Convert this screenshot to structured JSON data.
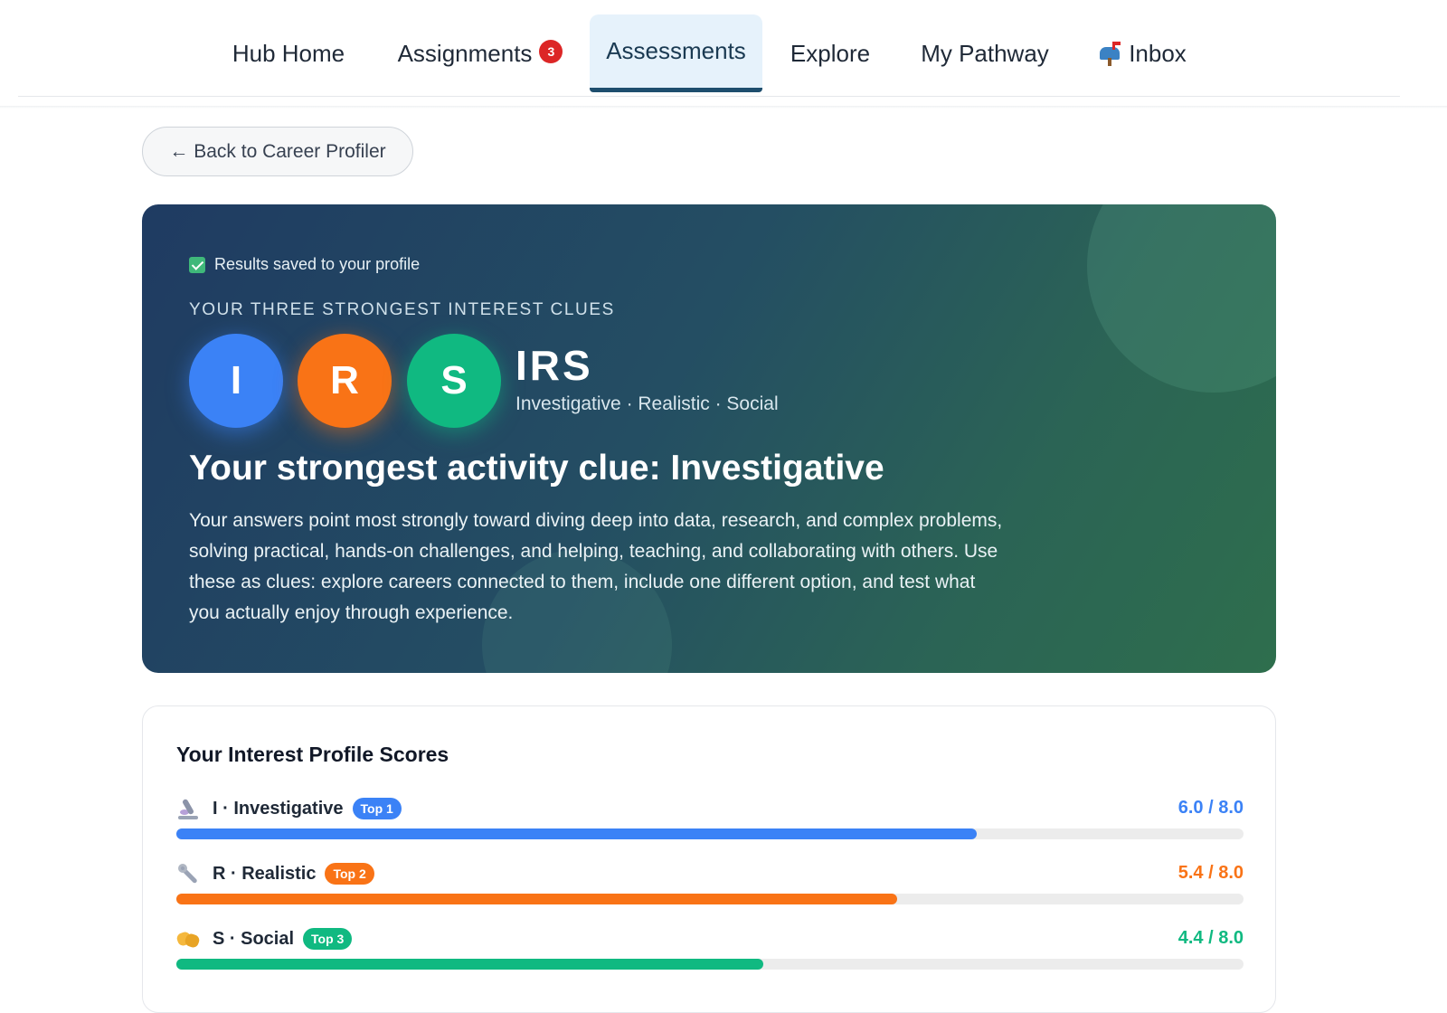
{
  "nav": {
    "tabs": [
      {
        "label": "Hub Home"
      },
      {
        "label": "Assignments",
        "badge": "3"
      },
      {
        "label": "Assessments",
        "active": true
      },
      {
        "label": "Explore"
      },
      {
        "label": "My Pathway"
      },
      {
        "label": "Inbox",
        "icon": "mailbox-icon"
      }
    ]
  },
  "back_button": {
    "label": "← Back to Career Profiler"
  },
  "hero": {
    "saved_text": "Results saved to your profile",
    "eyebrow": "YOUR THREE STRONGEST INTEREST CLUES",
    "letters": [
      "I",
      "R",
      "S"
    ],
    "code": "IRS",
    "code_names": "Investigative · Realistic · Social",
    "headline": "Your strongest activity clue: Investigative",
    "description": "Your answers point most strongly toward diving deep into data, research, and complex problems, solving practical, hands-on challenges, and helping, teaching, and collaborating with others. Use these as clues: explore careers connected to them, include one different option, and test what you actually enjoy through experience."
  },
  "scores": {
    "title": "Your Interest Profile Scores",
    "rows": [
      {
        "icon": "microscope-icon",
        "name": "I · Investigative",
        "tag": "Top 1",
        "score_text": "6.0 / 8.0",
        "value": 6.0,
        "max": 8.0,
        "color": "#3b82f6"
      },
      {
        "icon": "wrench-icon",
        "name": "R · Realistic",
        "tag": "Top 2",
        "score_text": "5.4 / 8.0",
        "value": 5.4,
        "max": 8.0,
        "color": "#f97316"
      },
      {
        "icon": "handshake-icon",
        "name": "S · Social",
        "tag": "Top 3",
        "score_text": "4.4 / 8.0",
        "value": 4.4,
        "max": 8.0,
        "color": "#10b981"
      }
    ]
  },
  "colors": {
    "nav_active_bg": "#e6f2fb",
    "nav_active_border": "#1e4e6e",
    "badge": "#dc2626",
    "investigative": "#3b82f6",
    "realistic": "#f97316",
    "social": "#10b981"
  }
}
